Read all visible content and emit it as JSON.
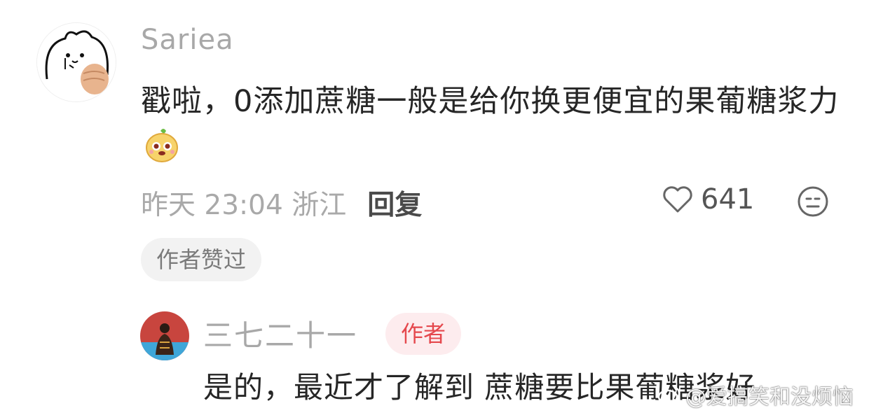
{
  "comment": {
    "username": "Sariea",
    "text": "戳啦，0添加蔗糖一般是给你换更便宜的果葡糖浆力",
    "emoji_icon": "pineapple-face-emoji-icon",
    "time": "昨天 23:04",
    "location": "浙江",
    "reply_label": "回复",
    "like_count": "641",
    "author_liked_badge": "作者赞过"
  },
  "reply": {
    "username": "三七二十一",
    "author_tag": "作者",
    "text": "是的，最近才了解到 蔗糖要比果葡糖浆好"
  },
  "watermark": {
    "text": "@爱搞笑和没烦恼",
    "icon": "weibo-icon"
  },
  "colors": {
    "username": "#a8a8a8",
    "text": "#262626",
    "author_tag_bg": "#fdecee",
    "author_tag_text": "#e5484d"
  }
}
